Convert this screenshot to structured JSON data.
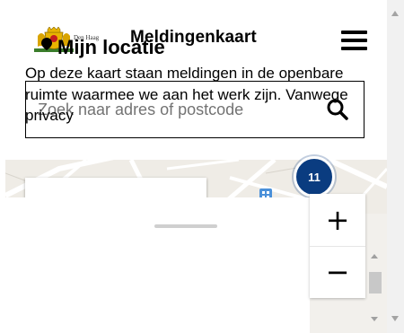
{
  "header": {
    "logo_text": "Den Haag",
    "title": "Meldingenkaart",
    "menu_icon": "hamburger-menu-icon"
  },
  "search": {
    "placeholder": "Zoek naar adres of postcode",
    "value": "",
    "icon": "search-icon"
  },
  "map": {
    "place_card_label": "Mijn locatie",
    "cluster_count": "11",
    "cluster_color": "#0a3c80",
    "zoom_in_label": "+",
    "zoom_out_label": "−"
  },
  "panel": {
    "text": "Op deze kaart staan meldingen in de openbare ruimte waarmee we aan het werk zijn. Vanwege privacy"
  }
}
